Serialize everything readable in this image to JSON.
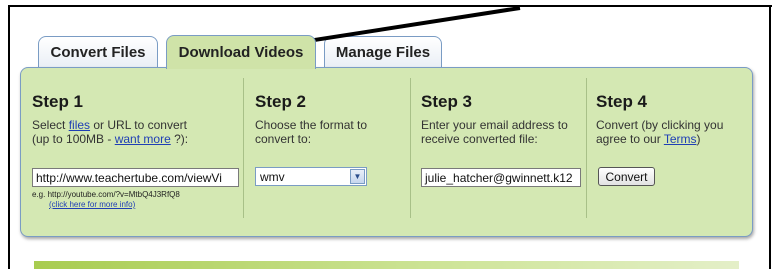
{
  "tabs": [
    {
      "label": "Convert Files"
    },
    {
      "label": "Download Videos"
    },
    {
      "label": "Manage Files"
    }
  ],
  "steps": [
    {
      "title": "Step 1",
      "desc_pre": "Select ",
      "desc_link1": "files",
      "desc_mid": " or URL to convert",
      "desc_line2_pre": "(up to 100MB - ",
      "desc_link2": "want more",
      "desc_line2_post": " ?):"
    },
    {
      "title": "Step 2",
      "desc_line1": "Choose the format to",
      "desc_line2": "convert to:"
    },
    {
      "title": "Step 3",
      "desc_line1": "Enter your email address to",
      "desc_line2": "receive converted file:"
    },
    {
      "title": "Step 4",
      "desc_line1": "Convert (by clicking you",
      "desc_line2_pre": "agree to our ",
      "desc_link": "Terms",
      "desc_line2_post": ")"
    }
  ],
  "url_input": {
    "value": "http://www.teachertube.com/viewVi"
  },
  "example_note": {
    "line1": "e.g.  http://youtube.com/?v=MtbQ4J3RfQ8",
    "link": "(click here for more info)"
  },
  "format_select": {
    "value": "wmv"
  },
  "email_input": {
    "value": "julie_hatcher@gwinnett.k12"
  },
  "convert_button": {
    "label": "Convert"
  },
  "colors": {
    "panel": "#d4e8b3",
    "link": "#1f3fb5",
    "tab_active": "#cfe3a8"
  }
}
